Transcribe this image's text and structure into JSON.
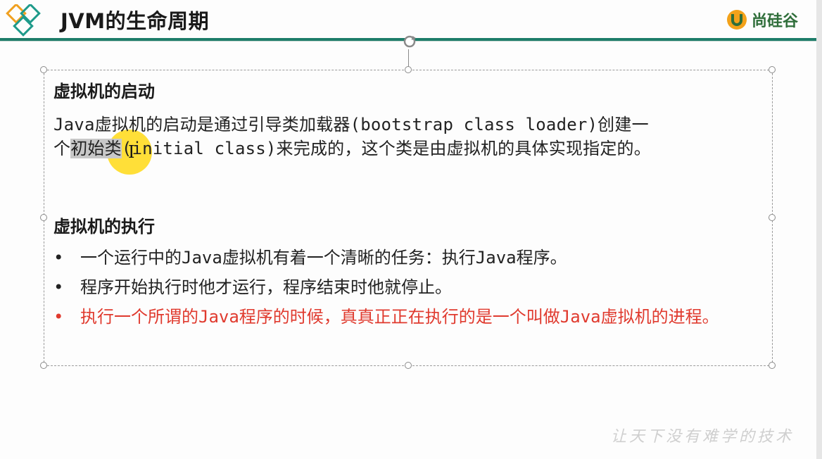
{
  "slide": {
    "title": "JVM的生命周期",
    "brand": "尚硅谷",
    "section1": {
      "heading": "虚拟机的启动",
      "line1": "Java虚拟机的启动是通过引导类加载器(bootstrap class loader)创建一",
      "line2_pre": "个",
      "line2_highlight": "初始类",
      "line2_post": "(initial class)来完成的，这个类是由虚拟机的具体实现指定的。"
    },
    "section2": {
      "heading": "虚拟机的执行",
      "bullets": [
        {
          "text": "一个运行中的Java虚拟机有着一个清晰的任务：执行Java程序。"
        },
        {
          "text": "程序开始执行时他才运行，程序结束时他就停止。"
        },
        {
          "text": "执行一个所谓的Java程序的时候，真真正正在执行的是一个叫做Java虚拟机的进程。"
        }
      ],
      "bullet_symbol": "•"
    },
    "watermark": "让天下没有难学的技术"
  },
  "colors": {
    "accent": "#1e7d6a",
    "brand": "#2f6e3a",
    "highlight_red": "#e03a2e",
    "cursor": "#ffd600"
  }
}
